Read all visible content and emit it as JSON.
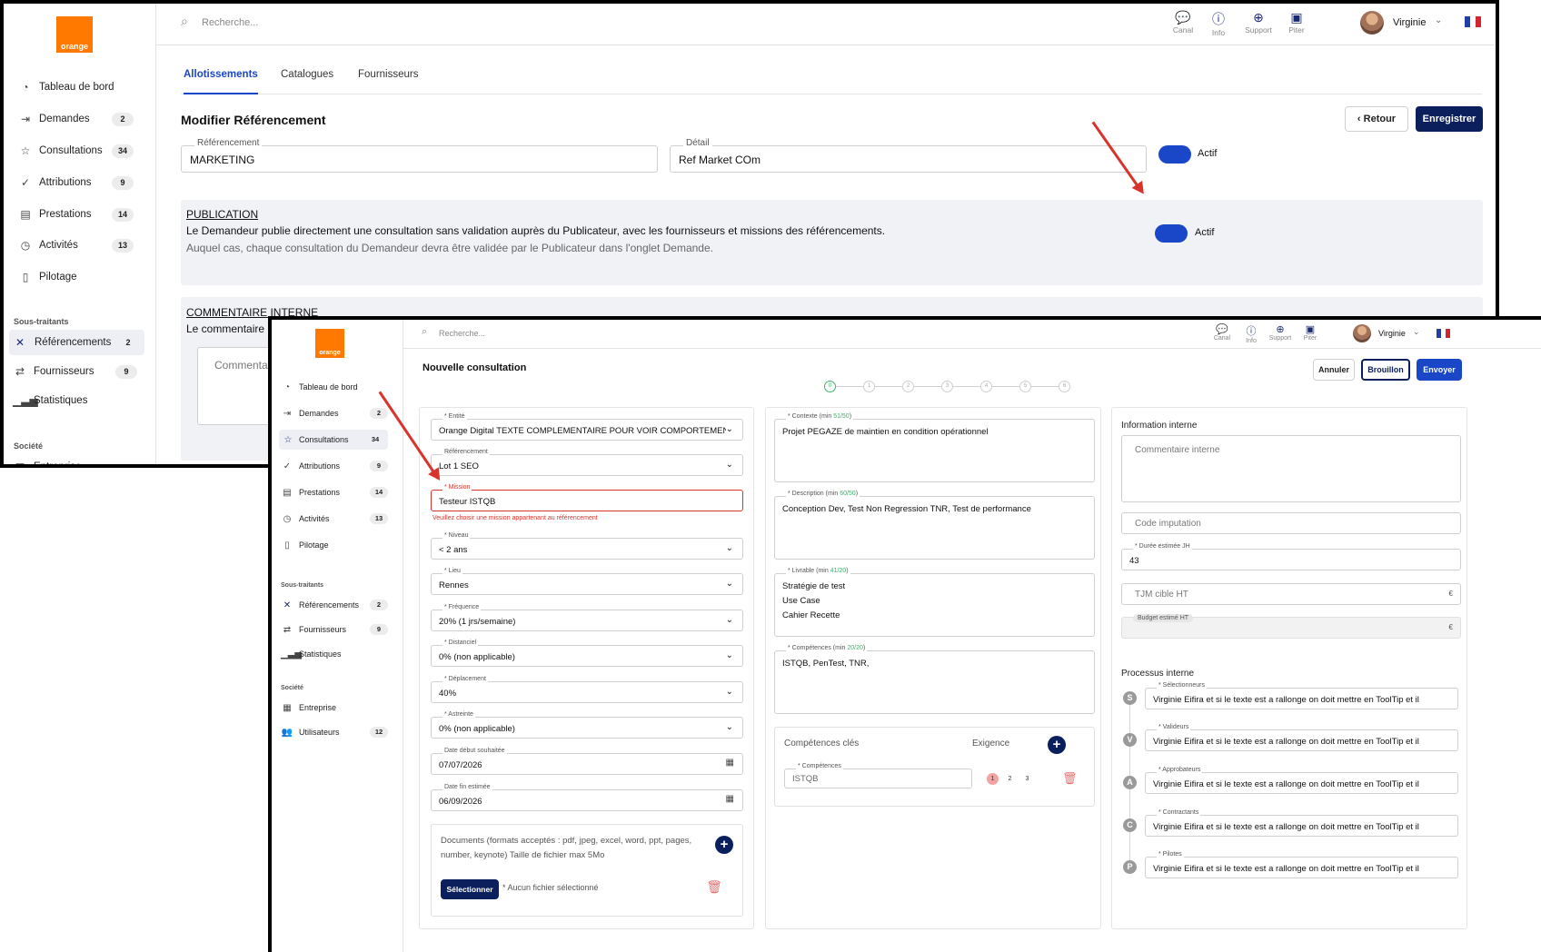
{
  "brand": {
    "logo_text": "orange",
    "orange": "#ff7900",
    "navy": "#0b1f5c",
    "blue": "#1a47c8",
    "red": "#d9342b"
  },
  "sidebar": {
    "items": [
      {
        "label": "Tableau de bord",
        "icon": "dashboard-icon",
        "badge": ""
      },
      {
        "label": "Demandes",
        "icon": "demand-icon",
        "badge": "2"
      },
      {
        "label": "Consultations",
        "icon": "star-icon",
        "badge": "34"
      },
      {
        "label": "Attributions",
        "icon": "check-icon",
        "badge": "9"
      },
      {
        "label": "Prestations",
        "icon": "document-icon",
        "badge": "14"
      },
      {
        "label": "Activités",
        "icon": "clock-icon",
        "badge": "13"
      },
      {
        "label": "Pilotage",
        "icon": "file-icon",
        "badge": ""
      }
    ],
    "section_subcontractors": "Sous-traitants",
    "sub_items": [
      {
        "label": "Référencements",
        "icon": "network-icon",
        "badge": "2"
      },
      {
        "label": "Fournisseurs",
        "icon": "supplier-icon",
        "badge": "9"
      },
      {
        "label": "Statistiques",
        "icon": "chart-icon",
        "badge": ""
      }
    ],
    "section_company": "Société",
    "company_items": [
      {
        "label": "Entreprise",
        "icon": "building-icon",
        "badge": ""
      },
      {
        "label": "Utilisateurs",
        "icon": "users-icon",
        "badge": "12"
      }
    ]
  },
  "topbar": {
    "search_placeholder": "Recherche...",
    "tools": [
      {
        "label": "Canal",
        "icon": "chat-icon"
      },
      {
        "label": "Info",
        "icon": "info-icon"
      },
      {
        "label": "Support",
        "icon": "support-icon"
      },
      {
        "label": "Piter",
        "icon": "piter-icon"
      }
    ],
    "user_name": "Virginie"
  },
  "referencement_page": {
    "tabs": [
      "Allotissements",
      "Catalogues",
      "Fournisseurs"
    ],
    "title": "Modifier Référencement",
    "back_label": "Retour",
    "save_label": "Enregistrer",
    "referencement_label": "Référencement",
    "referencement_value": "MARKETING",
    "detail_label": "Détail",
    "detail_value": "Ref Market COm",
    "active_label": "Actif",
    "publication": {
      "heading": "PUBLICATION",
      "text": "Le Demandeur publie directement une consultation sans validation auprès du Publicateur, avec les fournisseurs et missions des référencements.",
      "subtext": "Auquel cas, chaque consultation du Demandeur devra être validée par le Publicateur dans l'onglet Demande.",
      "active_label": "Actif"
    },
    "comment": {
      "heading": "COMMENTAIRE INTERNE",
      "text": "Le commentaire",
      "placeholder": "Commenta"
    }
  },
  "consultation_page": {
    "title": "Nouvelle consultation",
    "cancel_label": "Annuler",
    "draft_label": "Brouillon",
    "send_label": "Envoyer",
    "steps": [
      "0",
      "1",
      "2",
      "3",
      "4",
      "5",
      "6"
    ],
    "fields": {
      "entite": {
        "label": "* Entité",
        "value": "Orange Digital TEXTE COMPLEMENTAIRE POUR VOIR COMPORTEMENT Ulu"
      },
      "referencement": {
        "label": "Référencement",
        "value": "Lot 1 SEO"
      },
      "mission": {
        "label": "* Mission",
        "value": "Testeur ISTQB",
        "error": "Veuillez choisir une mission appartenant au référencement"
      },
      "niveau": {
        "label": "* Niveau",
        "value": "< 2 ans"
      },
      "lieu": {
        "label": "* Lieu",
        "value": "Rennes"
      },
      "frequence": {
        "label": "* Fréquence",
        "value": "20% (1 jrs/semaine)"
      },
      "distanciel": {
        "label": "* Distanciel",
        "value": "0% (non applicable)"
      },
      "deplacement": {
        "label": "* Déplacement",
        "value": "40%"
      },
      "astreinte": {
        "label": "* Astreinte",
        "value": "0% (non applicable)"
      },
      "date_debut": {
        "label": "Date début souhaitée",
        "value": "07/07/2026"
      },
      "date_fin": {
        "label": "Date fin estimée",
        "value": "06/09/2026"
      }
    },
    "documents": {
      "text": "Documents (formats acceptés : pdf, jpeg, excel, word, ppt, pages, number, keynote) Taille de fichier max 5Mo",
      "select_label": "Sélectionner",
      "no_file": "* Aucun fichier sélectionné"
    },
    "contexte": {
      "label": "* Contexte (min ",
      "count": "51/50",
      "value": "Projet PEGAZE de maintien en condition opérationnel"
    },
    "description": {
      "label": "* Description (min ",
      "count": "60/50",
      "value": "Conception Dev, Test Non Regression TNR, Test de performance"
    },
    "livrable": {
      "label": "* Livrable (min ",
      "count": "41/20",
      "lines": [
        "Stratégie de test",
        "Use Case",
        "Cahier Recette"
      ]
    },
    "competences": {
      "label": "* Compétences (min ",
      "count": "20/20",
      "value": "ISTQB, PenTest, TNR,"
    },
    "key_skills": {
      "title": "Compétences clés",
      "exigence": "Exigence",
      "field_label": "* Compétences",
      "field_value": "ISTQB",
      "levels": [
        "1",
        "2",
        "3"
      ],
      "selected_level": "1"
    },
    "info_interne": {
      "title": "Information interne",
      "comment_placeholder": "Commentaire interne",
      "code_placeholder": "Code imputation",
      "duree_label": "* Durée estimée JH",
      "duree_value": "43",
      "tjm_placeholder": "TJM cible HT",
      "budget_label": "Budget estimé HT",
      "currency": "€"
    },
    "processus": {
      "title": "Processus interne",
      "roles": [
        {
          "letter": "S",
          "label": "* Sélectionneurs",
          "value": "Virginie Eifira et si le texte est a rallonge on doit mettre en ToolTip et il"
        },
        {
          "letter": "V",
          "label": "* Valideurs",
          "value": "Virginie Eifira et si le texte est a rallonge on doit mettre en ToolTip et il"
        },
        {
          "letter": "A",
          "label": "* Approbateurs",
          "value": "Virginie Eifira et si le texte est a rallonge on doit mettre en ToolTip et il"
        },
        {
          "letter": "C",
          "label": "* Contractants",
          "value": "Virginie Eifira et si le texte est a rallonge on doit mettre en ToolTip et il"
        },
        {
          "letter": "P",
          "label": "* Pilotes",
          "value": "Virginie Eifira et si le texte est a rallonge on doit mettre en ToolTip et il"
        }
      ]
    }
  }
}
